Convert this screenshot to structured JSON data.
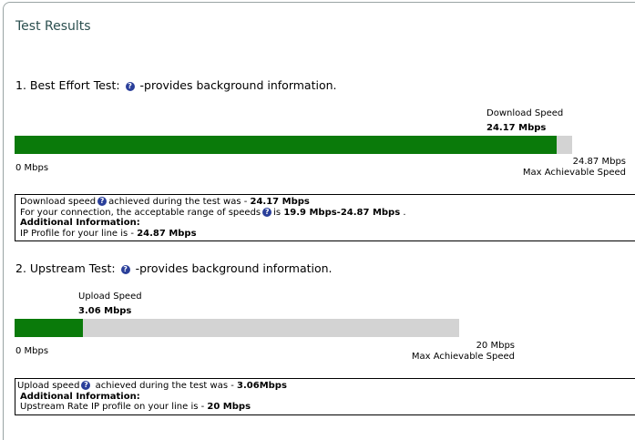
{
  "title": "Test Results",
  "colors": {
    "bar_fill": "#0a7a0a",
    "bar_track": "#d3d3d3",
    "help_icon": "#2a3f9a",
    "title": "#2b4f4f"
  },
  "best_effort": {
    "heading_prefix": "1. Best Effort Test:",
    "heading_suffix": "-provides background information.",
    "download_label": "Download Speed",
    "download_value": "24.17 Mbps",
    "fill_fraction": 0.9718,
    "min_label": "0 Mbps",
    "max_value": "24.87 Mbps",
    "max_label": "Max Achievable Speed",
    "info": {
      "line1_a": "Download speed",
      "line1_b": "achieved during the test was - ",
      "line1_val": "24.17 Mbps",
      "line2_a": "For your connection, the acceptable range of speeds",
      "line2_b": "is ",
      "line2_val": "19.9 Mbps-24.87 Mbps",
      "line2_end": " .",
      "line3": "Additional Information:",
      "line4_a": "IP Profile for your line is - ",
      "line4_val": "24.87 Mbps"
    }
  },
  "upstream": {
    "heading_prefix": "2. Upstream Test:",
    "heading_suffix": "-provides background information.",
    "upload_label": "Upload Speed",
    "upload_value": "3.06 Mbps",
    "fill_fraction": 0.153,
    "min_label": "0 Mbps",
    "max_value": "20 Mbps",
    "max_label": "Max Achievable Speed",
    "info": {
      "line1_a": "Upload speed",
      "line1_b": " achieved during the test was - ",
      "line1_val": "3.06Mbps",
      "line2": "Additional Information:",
      "line3_a": "Upstream Rate IP profile on your line is - ",
      "line3_val": "20 Mbps"
    }
  },
  "help_icon": "question-mark-circle-icon"
}
